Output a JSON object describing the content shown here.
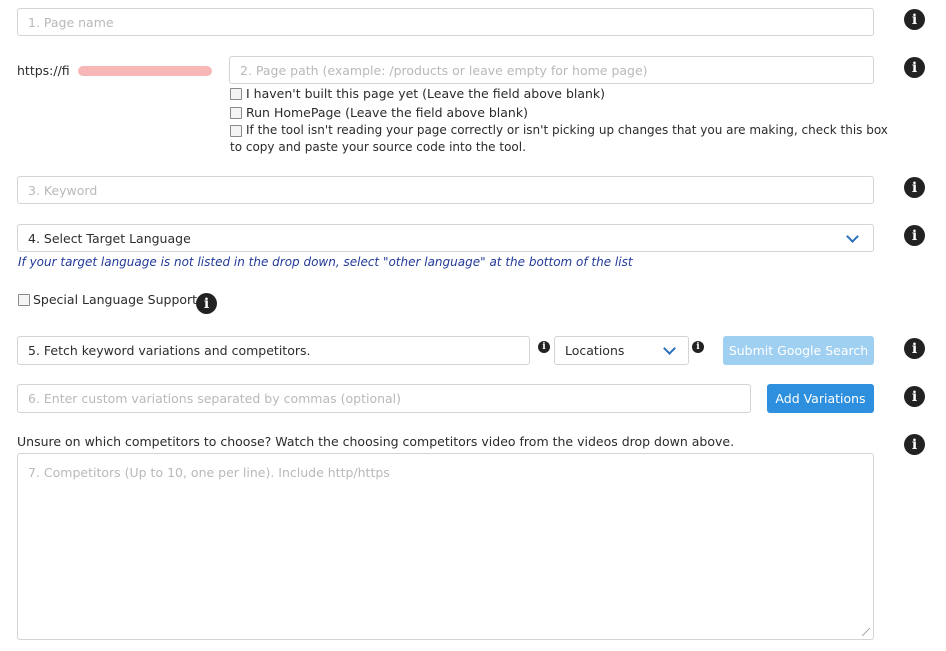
{
  "page_name": {
    "placeholder": "1. Page name"
  },
  "url_prefix": "https://fi",
  "page_path": {
    "placeholder": "2. Page path (example: /products or leave empty for home page)"
  },
  "checkboxes": {
    "not_built": "I haven't built this page yet (Leave the field above blank)",
    "run_homepage": "Run HomePage (Leave the field above blank)",
    "paste_source_line1": "If the tool isn't reading your page correctly or isn't picking up changes that you are making, check this box",
    "paste_source_line2": "to copy and paste your source code into the tool."
  },
  "keyword": {
    "placeholder": "3. Keyword"
  },
  "language": {
    "selected": "4. Select Target Language",
    "note": "If your target language is not listed in the drop down, select \"other language\" at the bottom of the list"
  },
  "special_language": {
    "label": "Special Language Support"
  },
  "fetch": {
    "value": "5. Fetch keyword variations and competitors.",
    "locations_selected": "Locations",
    "submit_label": "Submit Google Search"
  },
  "variations": {
    "placeholder": "6. Enter custom variations separated by commas (optional)",
    "add_label": "Add Variations"
  },
  "competitors": {
    "hint": "Unsure on which competitors to choose? Watch the choosing competitors video from the videos drop down above.",
    "placeholder": "7. Competitors (Up to 10, one per line). Include http/https"
  },
  "info_glyph": "i",
  "colors": {
    "submit_disabled": "#9fd0f2",
    "add_button": "#2d8fde",
    "note_text": "#223a9a",
    "redaction": "#f7b7b7"
  }
}
